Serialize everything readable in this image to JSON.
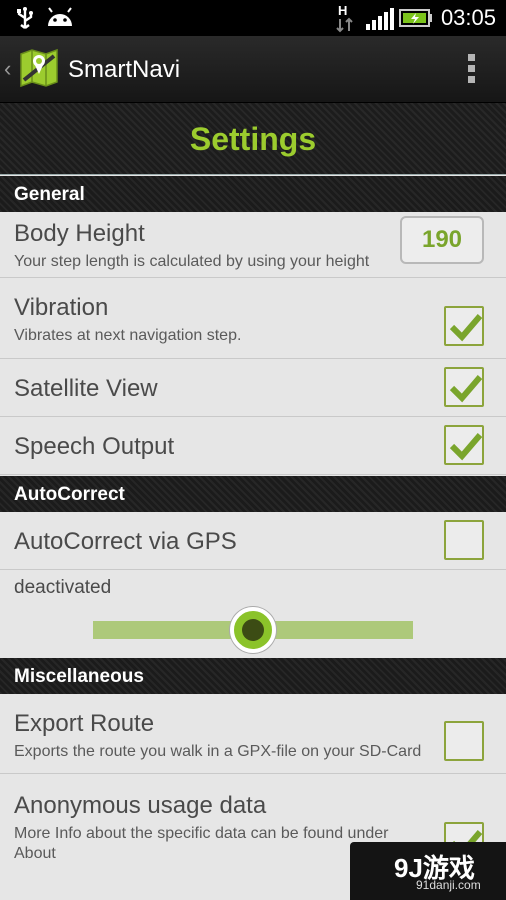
{
  "status_bar": {
    "time": "03:05",
    "icons": [
      "usb-icon",
      "android-icon",
      "network-h-icon",
      "signal-icon",
      "battery-icon"
    ]
  },
  "action_bar": {
    "app_title": "SmartNavi",
    "icons": [
      "up-caret-icon",
      "app-logo-icon",
      "overflow-menu-icon"
    ]
  },
  "page": {
    "title": "Settings"
  },
  "sections": {
    "general": "General",
    "autocorrect": "AutoCorrect",
    "misc": "Miscellaneous"
  },
  "prefs": {
    "body_height": {
      "title": "Body Height",
      "summary": "Your step length is calculated by using your height",
      "value": "190"
    },
    "vibration": {
      "title": "Vibration",
      "summary": "Vibrates at next navigation step.",
      "checked": true
    },
    "satellite_view": {
      "title": "Satellite View",
      "checked": true
    },
    "speech_output": {
      "title": "Speech Output",
      "checked": true
    },
    "autocorrect_gps": {
      "title": "AutoCorrect via GPS",
      "checked": false
    },
    "autocorrect_level": {
      "label": "deactivated",
      "slider_fraction": 0.5
    },
    "export_route": {
      "title": "Export Route",
      "summary": "Exports the route you walk in a GPX-file on your SD-Card",
      "checked": false
    },
    "usage_data": {
      "title": "Anonymous usage data",
      "summary": "More Info about the specific data can be found under About",
      "checked": true
    }
  },
  "watermark": {
    "brand": "9J游戏",
    "url": "91danji.com"
  },
  "colors": {
    "accent": "#9ccc2e",
    "check": "#7aa52c",
    "header_bg": "#1b1b1b",
    "list_bg": "#e6e6e6"
  }
}
